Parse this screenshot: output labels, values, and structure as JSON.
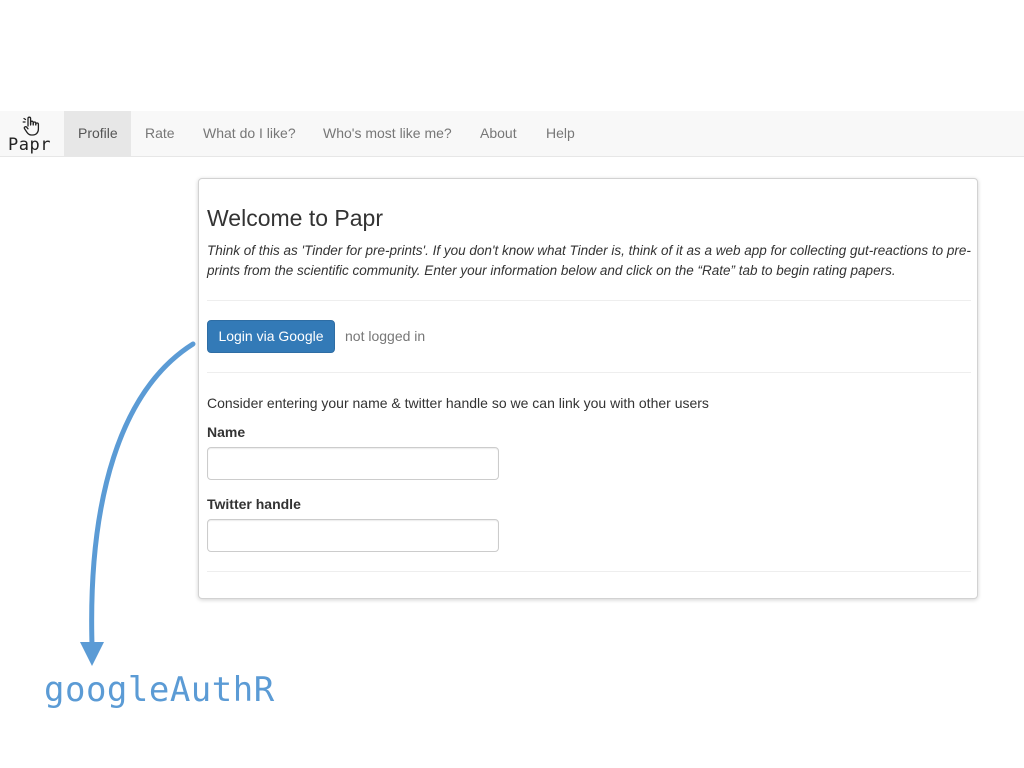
{
  "navbar": {
    "brand": "Papr",
    "items": [
      {
        "label": "Profile",
        "active": true
      },
      {
        "label": "Rate",
        "active": false
      },
      {
        "label": "What do I like?",
        "active": false
      },
      {
        "label": "Who's most like me?",
        "active": false
      },
      {
        "label": "About",
        "active": false
      },
      {
        "label": "Help",
        "active": false
      }
    ]
  },
  "panel": {
    "title": "Welcome to Papr",
    "intro": "Think of this as 'Tinder for pre-prints'. If you don't know what Tinder is, think of it as a web app for collecting gut-reactions to pre-prints from the scientific community. Enter your information below and click on the “Rate” tab to begin rating papers.",
    "login_button": "Login via Google",
    "login_status": "not logged in",
    "consider_text": "Consider entering your name & twitter handle so we can link you with other users",
    "name_label": "Name",
    "name_value": "",
    "twitter_label": "Twitter handle",
    "twitter_value": ""
  },
  "annotation": {
    "label": "googleAuthR",
    "color": "#5b9bd5"
  },
  "colors": {
    "primary": "#337ab7",
    "navbar_bg": "#f8f8f8",
    "active_tab_bg": "#e7e7e7"
  },
  "icons": {
    "brand": "hand-pointer-icon"
  }
}
